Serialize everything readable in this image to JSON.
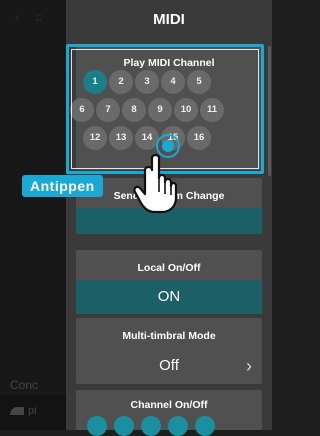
{
  "header": {
    "title": "MIDI"
  },
  "background": {
    "section_label": "Conc",
    "list_item_label": "pi"
  },
  "play_midi_channel": {
    "label": "Play MIDI Channel",
    "selected": "1",
    "rows": [
      [
        "1",
        "2",
        "3",
        "4",
        "5"
      ],
      [
        "6",
        "7",
        "8",
        "9",
        "10",
        "11"
      ],
      [
        "12",
        "13",
        "14",
        "15",
        "16"
      ]
    ]
  },
  "send_program_change": {
    "label_left": "Send Pro",
    "label_right": "m Change"
  },
  "local_on_off": {
    "label": "Local On/Off",
    "value": "ON"
  },
  "multi_timbral_mode": {
    "label": "Multi-timbral Mode",
    "value": "Off"
  },
  "channel_on_off": {
    "label": "Channel On/Off"
  },
  "callout": {
    "text": "Antippen"
  },
  "colors": {
    "accent": "#1aa9d4",
    "selected_channel": "#1b7f8a",
    "value_bar": "#1d5f66"
  },
  "icons": [
    "hand-pointer-icon",
    "chevron-right-icon",
    "piano-icon"
  ]
}
